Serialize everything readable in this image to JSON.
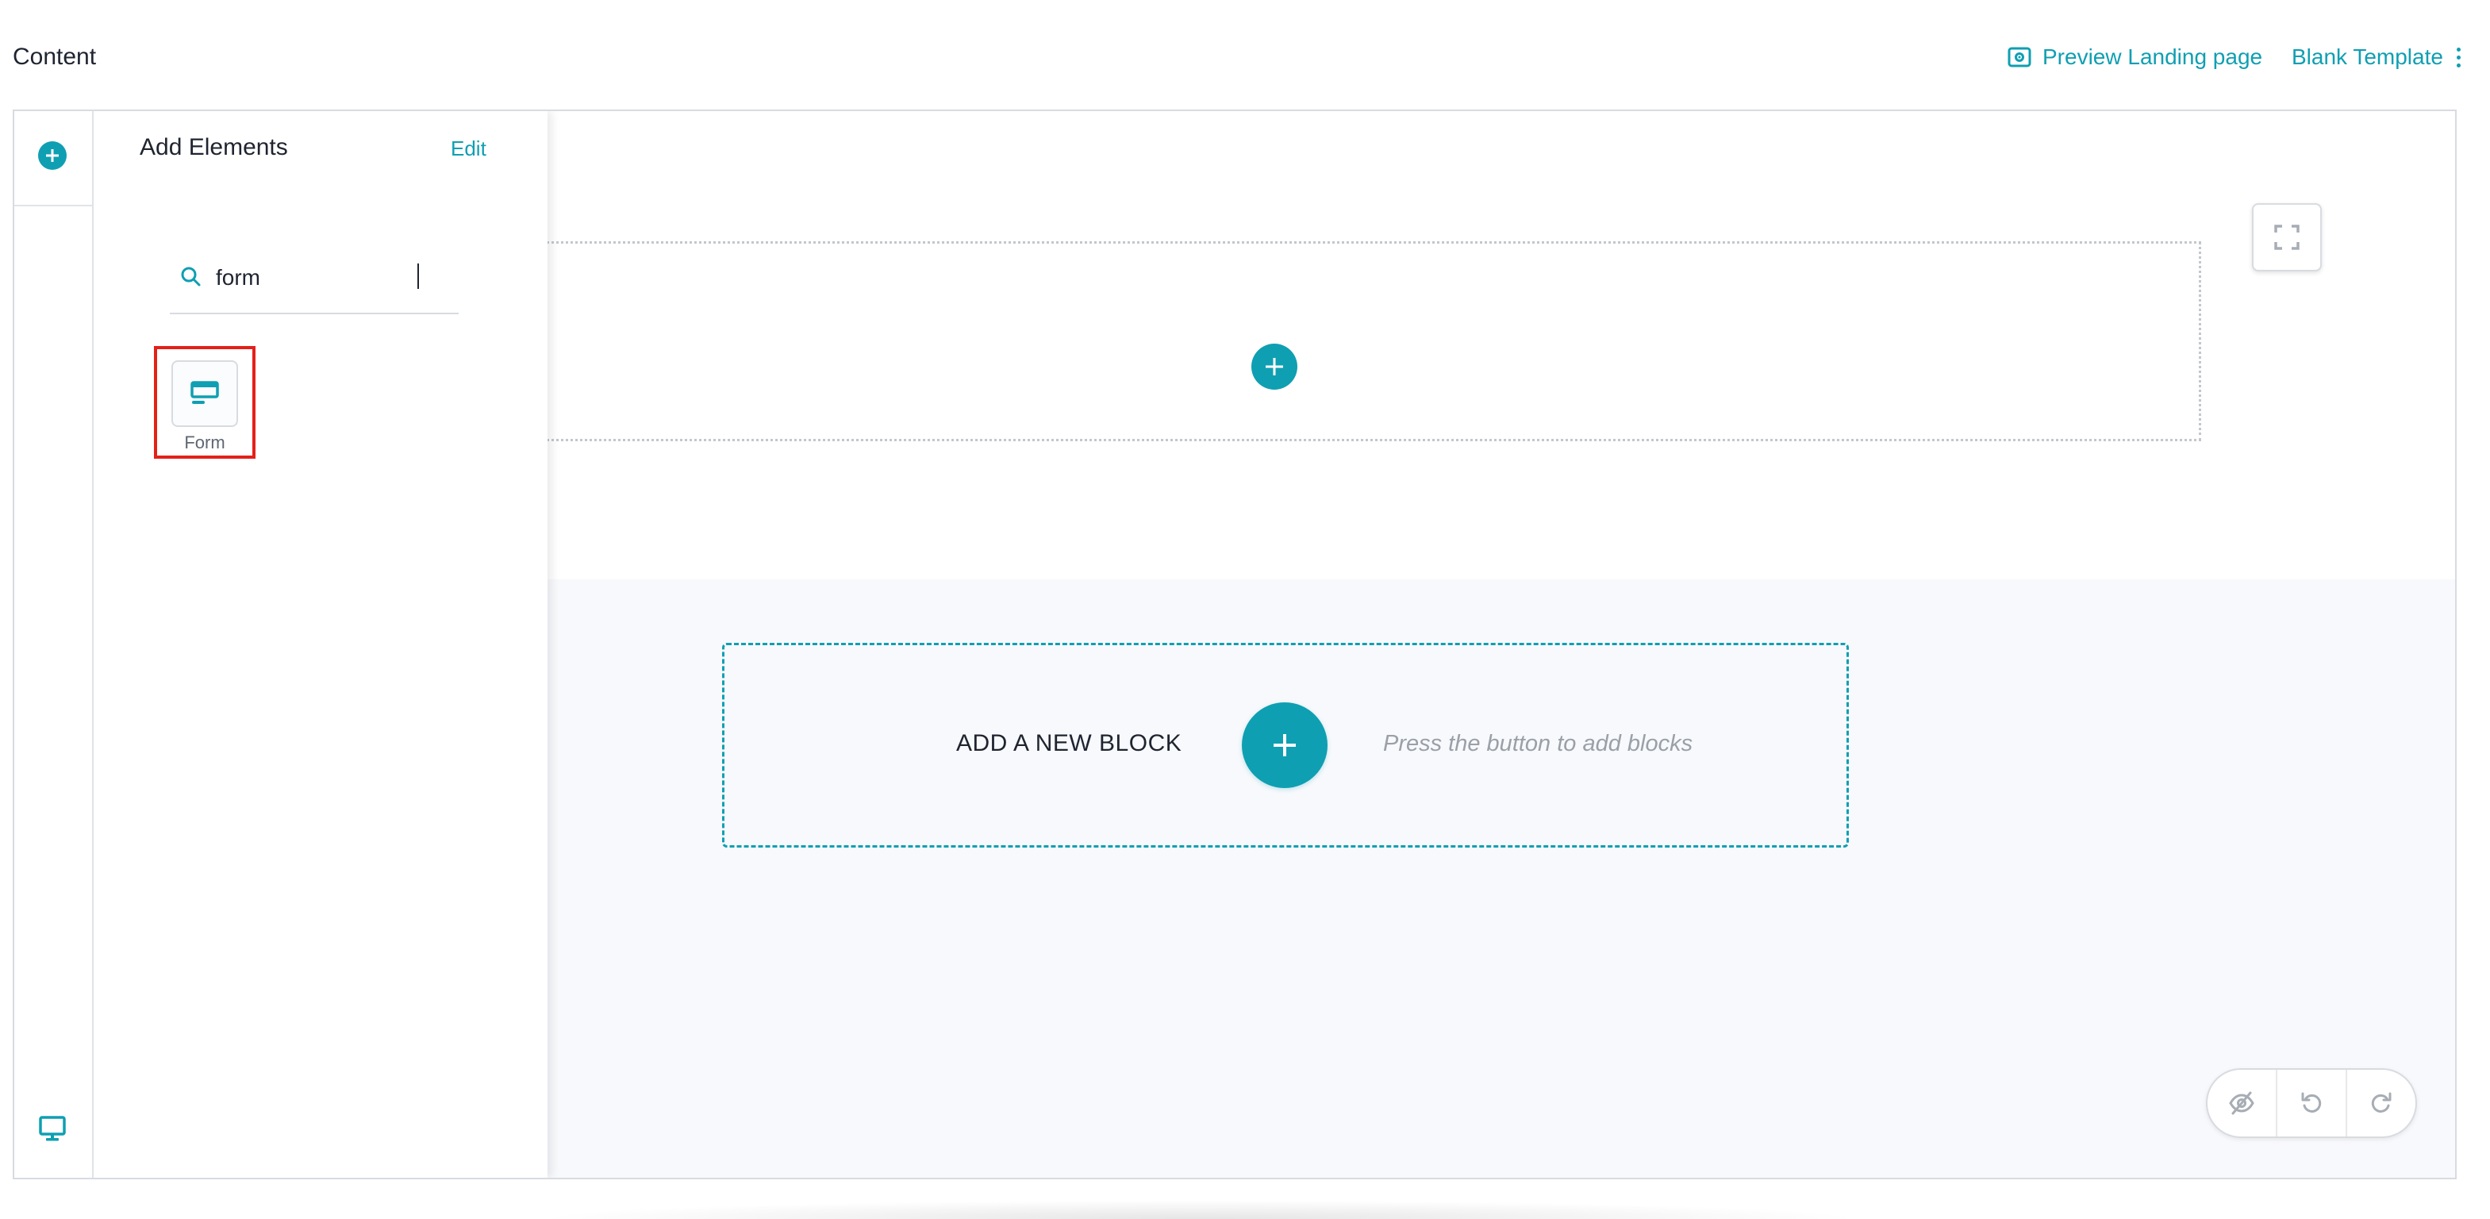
{
  "header": {
    "title": "Content",
    "preview_label": "Preview Landing page",
    "template_label": "Blank Template"
  },
  "panel": {
    "title": "Add Elements",
    "edit_label": "Edit",
    "search": {
      "value": "form",
      "placeholder": ""
    },
    "elements": [
      {
        "label": "Form",
        "icon": "form-icon",
        "highlighted": true
      }
    ]
  },
  "canvas": {
    "new_block_label": "ADD A NEW BLOCK",
    "new_block_hint": "Press the button to add blocks"
  },
  "colors": {
    "accent": "#0f9fb2",
    "highlight": "#e4201a",
    "canvas_bg": "#f8f9fc",
    "border": "#d8dbe0"
  }
}
